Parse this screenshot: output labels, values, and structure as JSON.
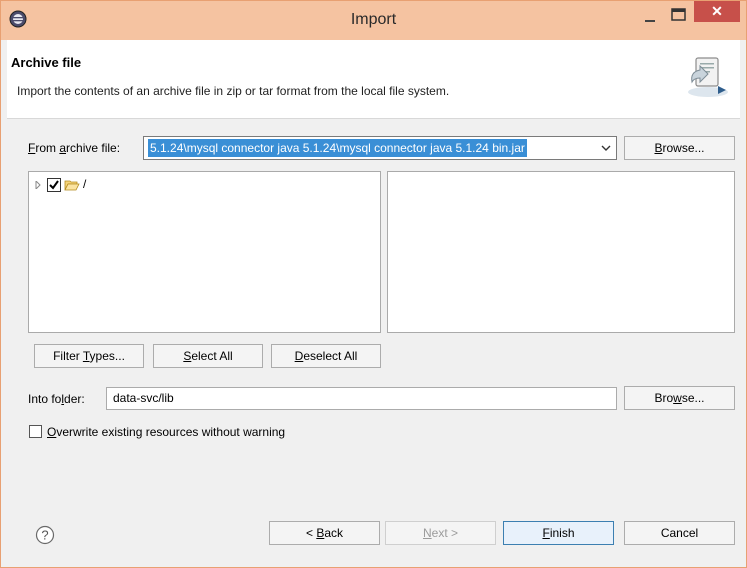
{
  "window": {
    "title": "Import"
  },
  "banner": {
    "title": "Archive file",
    "description": "Import the contents of an archive file in zip or tar format from the local file system."
  },
  "archive": {
    "label_pre": "",
    "label_accel": "F",
    "label_mid": "rom ",
    "label_accel2": "a",
    "label_post": "rchive file:",
    "value": "5.1.24\\mysql connector java 5.1.24\\mysql connector java 5.1.24 bin.jar",
    "browse_pre": "B",
    "browse_post": "rowse..."
  },
  "tree": {
    "root_label": "/"
  },
  "buttons": {
    "filter_pre": "Filter ",
    "filter_accel": "T",
    "filter_post": "ypes...",
    "select_accel": "S",
    "select_post": "elect All",
    "deselect_accel": "D",
    "deselect_post": "eselect All"
  },
  "folder": {
    "label_pre": "Into fo",
    "label_accel": "l",
    "label_post": "der:",
    "value": "data-svc/lib",
    "browse_pre": "Bro",
    "browse_accel": "w",
    "browse_post": "se..."
  },
  "overwrite": {
    "accel": "O",
    "label_post": "verwrite existing resources without warning"
  },
  "footer": {
    "back_pre": "< ",
    "back_accel": "B",
    "back_post": "ack",
    "next_accel": "N",
    "next_post": "ext >",
    "finish_accel": "F",
    "finish_post": "inish",
    "cancel": "Cancel"
  },
  "colors": {
    "titlebar": "#f5c3a1",
    "close": "#c7504a",
    "selection": "#3a8fd6",
    "default_button_border": "#3c7fb1"
  }
}
